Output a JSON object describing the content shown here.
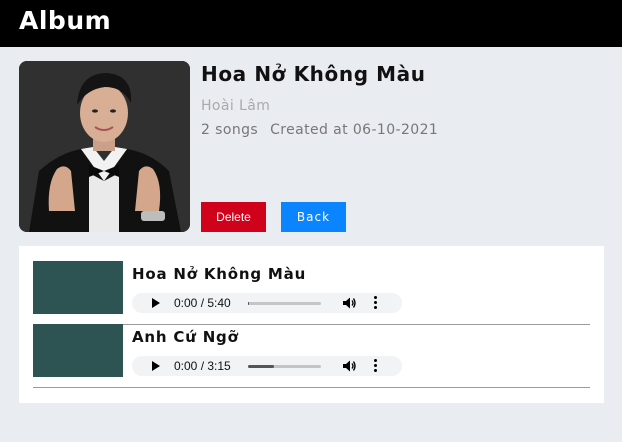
{
  "header": {
    "title": "Album"
  },
  "album": {
    "title": "Hoa Nở Không Màu",
    "artist": "Hoài Lâm",
    "song_count": "2 songs",
    "created": "Created at 06-10-2021",
    "cover_icon": "artist-photo"
  },
  "actions": {
    "delete_label": "Delete",
    "back_label": "Back"
  },
  "colors": {
    "delete": "#d0021b",
    "back": "#0a84ff",
    "thumb": "#2d5452",
    "header": "#000000"
  },
  "songs": [
    {
      "title": "Hoa Nở Không Màu",
      "time": "0:00 / 5:40",
      "progress": 0.02
    },
    {
      "title": "Anh Cứ Ngỡ",
      "time": "0:00 / 3:15",
      "progress": 0.35
    }
  ]
}
